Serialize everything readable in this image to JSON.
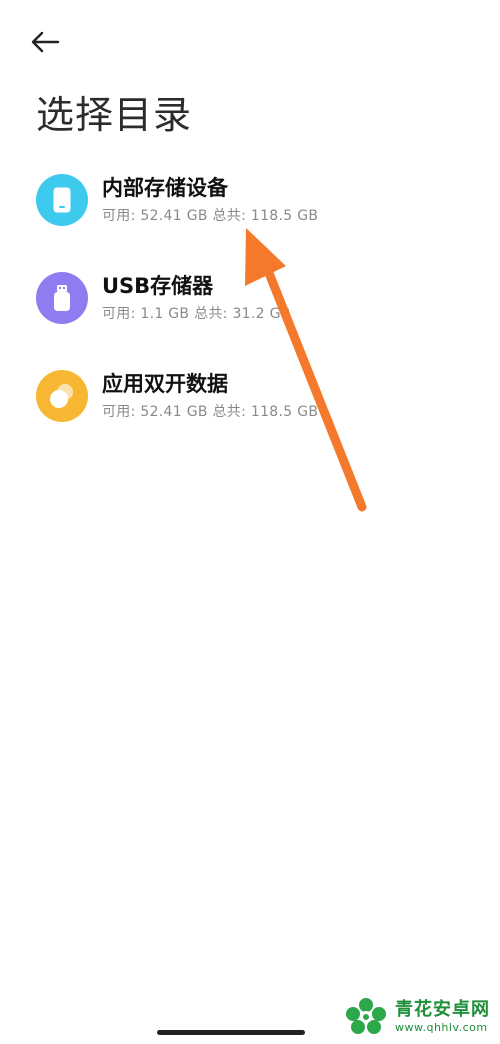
{
  "header": {
    "back_icon": "arrow-left-icon",
    "title": "选择目录"
  },
  "storage_items": [
    {
      "name": "内部存储设备",
      "detail": "可用: 52.41 GB 总共: 118.5 GB",
      "icon": "phone-storage-icon",
      "color": "#3ec9ef"
    },
    {
      "name": "USB存储器",
      "detail": "可用: 1.1 GB 总共: 31.2 GB",
      "icon": "usb-drive-icon",
      "color": "#8f7cf0"
    },
    {
      "name": "应用双开数据",
      "detail": "可用: 52.41 GB 总共: 118.5 GB",
      "icon": "dual-app-icon",
      "color": "#f7b733"
    }
  ],
  "annotation": {
    "arrow_color": "#f5792a",
    "arrow_icon": "annotation-arrow"
  },
  "watermark": {
    "name": "青花安卓网",
    "url": "www.qhhlv.com",
    "color": "#1f8f3a"
  }
}
